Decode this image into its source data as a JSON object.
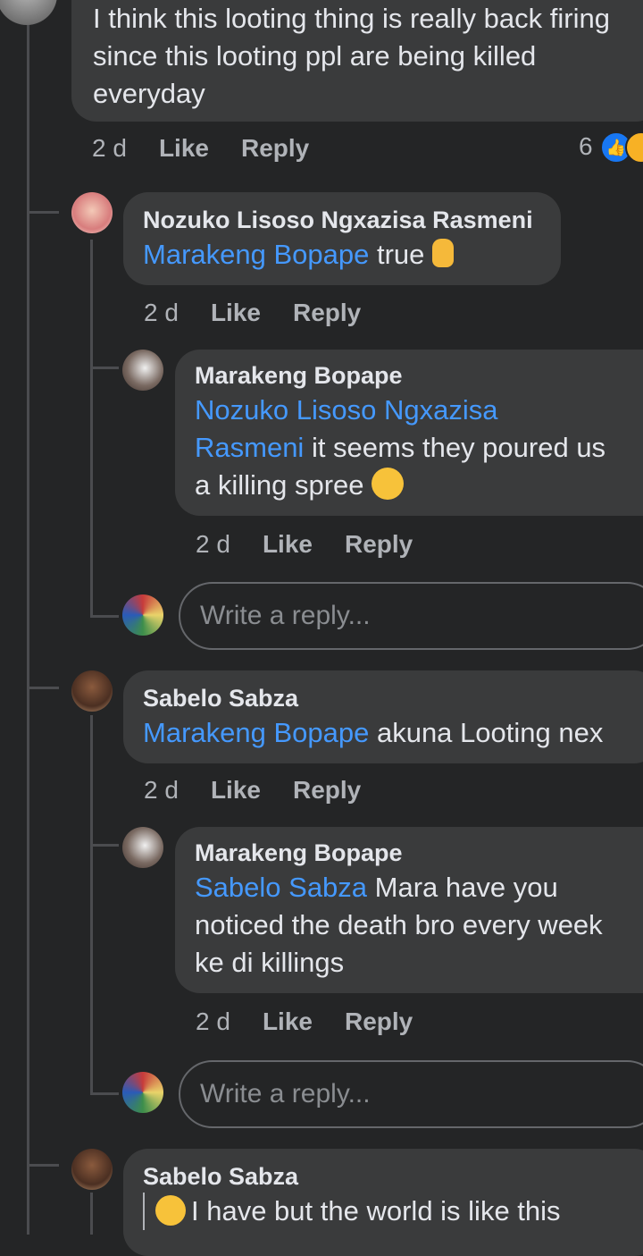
{
  "top_comment": {
    "text": "I think this looting thing is really back firing since this looting ppl are being killed everyday",
    "time": "2 d",
    "like": "Like",
    "reply": "Reply",
    "reaction_count": "6"
  },
  "replies": [
    {
      "author": "Nozuko Lisoso Ngxazisa Rasmeni",
      "mention": "Marakeng Bopape",
      "text": " true",
      "time": "2 d",
      "like": "Like",
      "reply": "Reply"
    },
    {
      "author": "Marakeng Bopape",
      "mention_l1": "Nozuko Lisoso Ngxazisa",
      "mention_l2": "Rasmeni",
      "text_l2": " it seems they poured us",
      "text_l3": "a killing spree",
      "time": "2 d",
      "like": "Like",
      "reply": "Reply"
    },
    {
      "author": "Sabelo Sabza",
      "mention": "Marakeng Bopape",
      "text": " akuna Looting nex",
      "time": "2 d",
      "like": "Like",
      "reply": "Reply"
    },
    {
      "author": "Marakeng Bopape",
      "mention": "Sabelo Sabza",
      "text_l1": " Mara have you",
      "text_l2": "noticed the death bro every week",
      "text_l3": "ke di killings",
      "time": "2 d",
      "like": "Like",
      "reply": "Reply"
    },
    {
      "author": "Sabelo Sabza",
      "text": "I have but the world is like this"
    }
  ],
  "reply_placeholder": "Write a reply...",
  "colors": {
    "background": "#242526",
    "bubble": "#3a3b3c",
    "mention": "#4599ff",
    "meta": "#b0b3b8"
  }
}
